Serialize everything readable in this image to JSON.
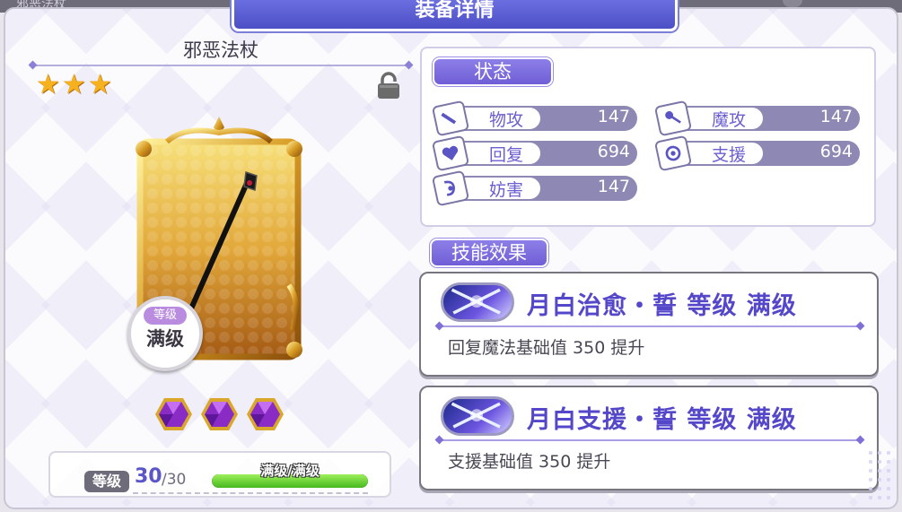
{
  "window": {
    "title": "装备详情",
    "behind_title": "邪恶法杖"
  },
  "item": {
    "name": "邪恶法杖",
    "stars": 3,
    "star_glyph": "★",
    "locked": true,
    "badge_top": "等级",
    "badge_main": "满级",
    "gem_count": 3
  },
  "level": {
    "label": "等级",
    "current": "30",
    "max": "/30",
    "bar_text": "满级/满级",
    "progress": 1.0
  },
  "status": {
    "header": "状态",
    "stats": [
      {
        "name": "物攻",
        "value": "147",
        "icon": "sword-icon"
      },
      {
        "name": "魔攻",
        "value": "147",
        "icon": "wand-icon"
      },
      {
        "name": "回复",
        "value": "694",
        "icon": "heart-icon"
      },
      {
        "name": "支援",
        "value": "694",
        "icon": "target-icon"
      },
      {
        "name": "妨害",
        "value": "147",
        "icon": "debuff-icon"
      }
    ]
  },
  "skills": {
    "header": "技能效果",
    "items": [
      {
        "title": "月白治愈・誓 等级 满级",
        "desc": "回复魔法基础值 350 提升"
      },
      {
        "title": "月白支援・誓 等级 满级",
        "desc": "支援基础值 350 提升"
      }
    ]
  },
  "colors": {
    "accent": "#6a5ed0",
    "title_tab": "#5558cc",
    "stat_bar": "#8d89b4",
    "star": "#f6b21e",
    "level_bar": "#5bc528"
  }
}
